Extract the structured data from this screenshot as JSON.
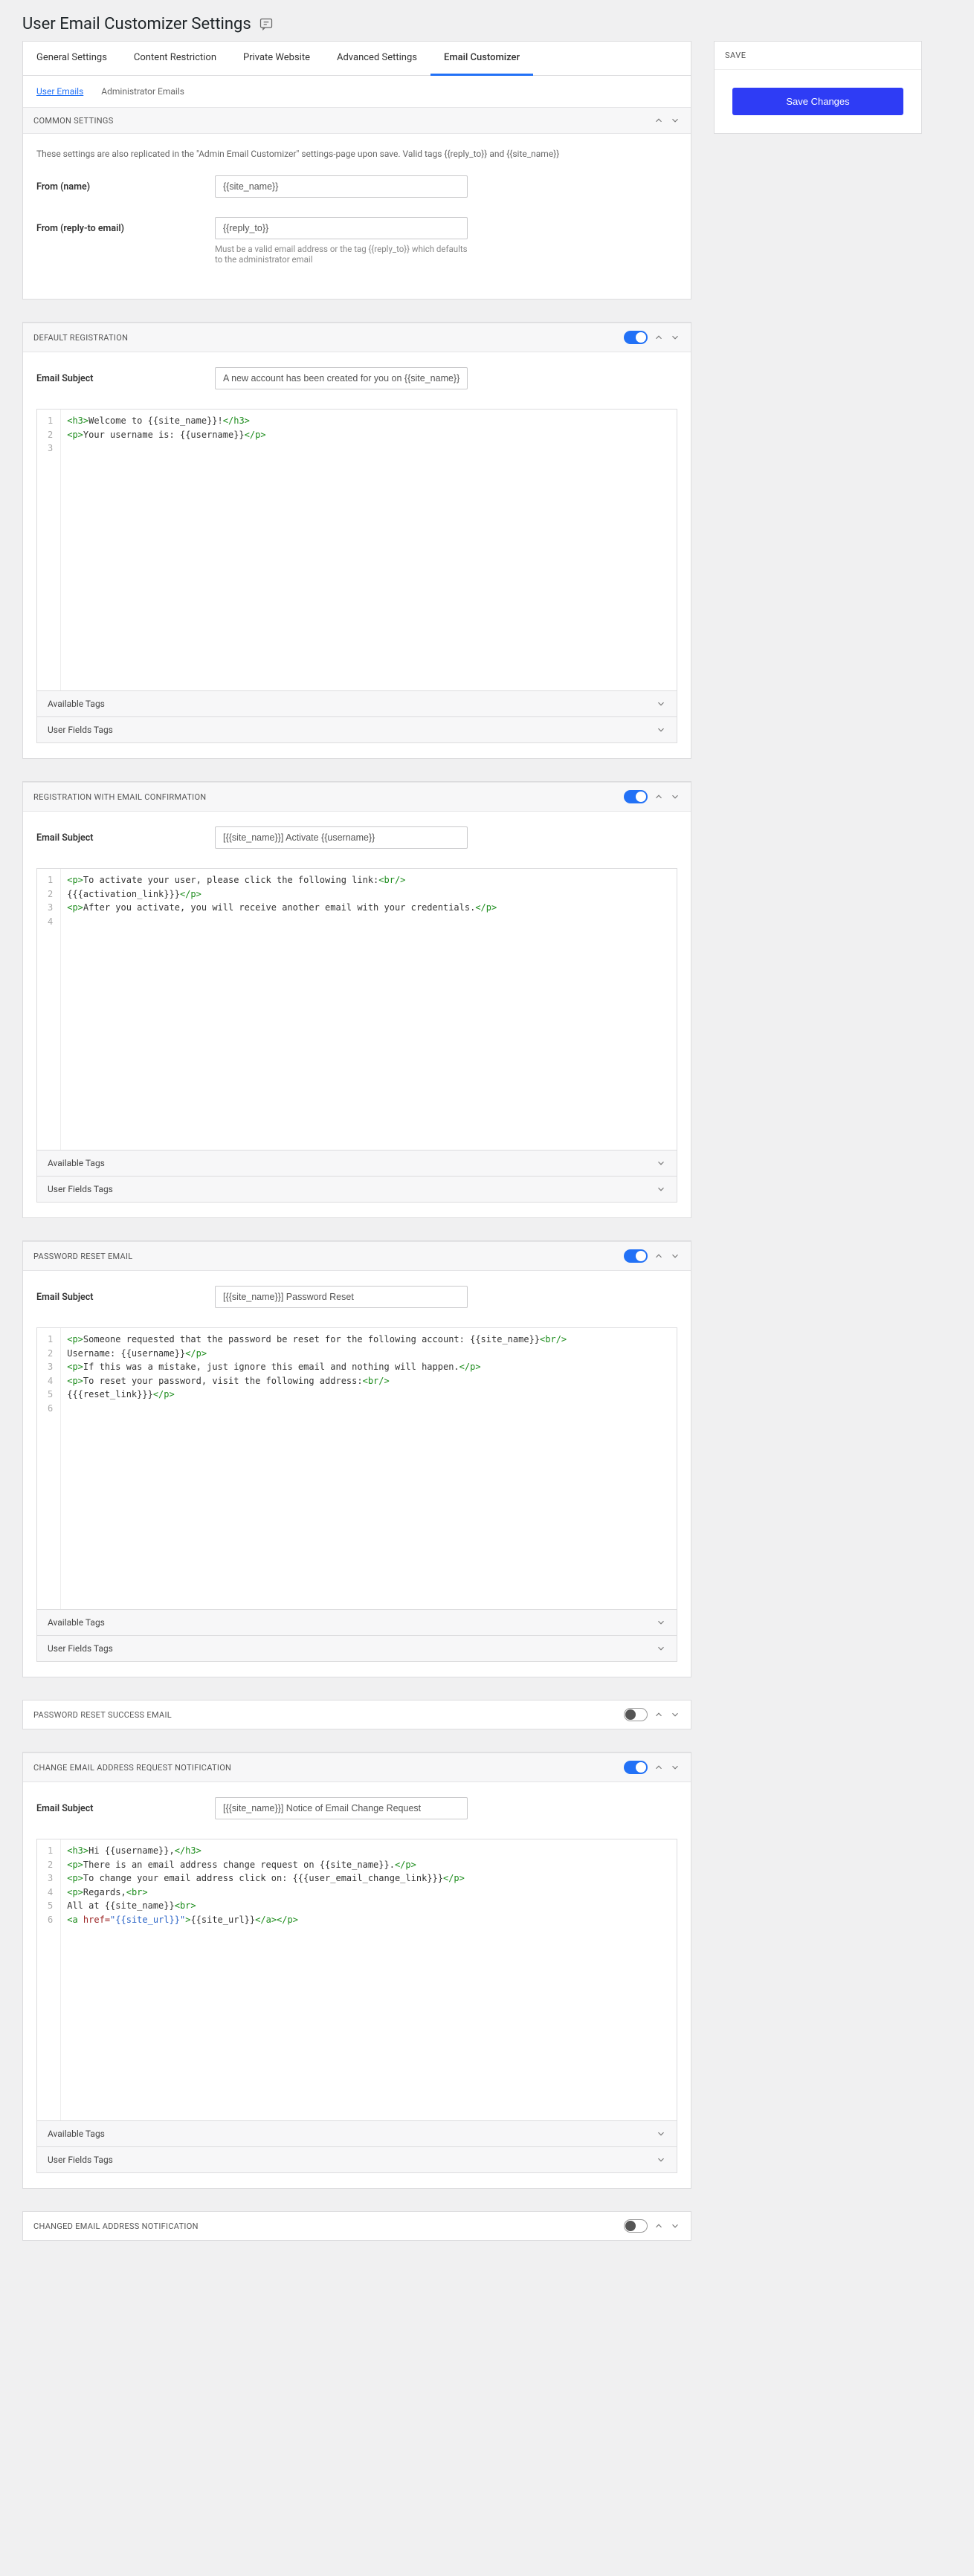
{
  "page_title": "User Email Customizer Settings",
  "tabs": [
    "General Settings",
    "Content Restriction",
    "Private Website",
    "Advanced Settings",
    "Email Customizer"
  ],
  "active_tab": 4,
  "subtabs": [
    "User Emails",
    "Administrator Emails"
  ],
  "active_subtab": 0,
  "save_panel": {
    "header": "SAVE",
    "button": "Save Changes"
  },
  "tag_groups": {
    "available": "Available Tags",
    "user_fields": "User Fields Tags"
  },
  "common": {
    "header": "COMMON SETTINGS",
    "hint": "These settings are also replicated in the \"Admin Email Customizer\" settings-page upon save. Valid tags {{reply_to}} and {{site_name}}",
    "from_name_label": "From (name)",
    "from_name_value": "{{site_name}}",
    "from_reply_label": "From (reply-to email)",
    "from_reply_value": "{{reply_to}}",
    "from_reply_hint": "Must be a valid email address or the tag {{reply_to}} which defaults to the administrator email"
  },
  "default_reg": {
    "header": "DEFAULT REGISTRATION",
    "enabled": true,
    "subject_label": "Email Subject",
    "subject_value": "A new account has been created for you on {{site_name}}",
    "code_lines": [
      [
        {
          "c": "tag",
          "t": "<h3>"
        },
        {
          "t": "Welcome to {{site_name}}!"
        },
        {
          "c": "tag",
          "t": "</h3>"
        }
      ],
      [
        {
          "c": "tag",
          "t": "<p>"
        },
        {
          "t": "Your username is: {{username}}"
        },
        {
          "c": "tag",
          "t": "</p>"
        }
      ],
      []
    ]
  },
  "reg_confirm": {
    "header": "REGISTRATION WITH EMAIL CONFIRMATION",
    "enabled": true,
    "subject_label": "Email Subject",
    "subject_value": "[{{site_name}}] Activate {{username}}",
    "code_lines": [
      [
        {
          "c": "tag",
          "t": "<p>"
        },
        {
          "t": "To activate your user, please click the following link:"
        },
        {
          "c": "tag",
          "t": "<br/>"
        }
      ],
      [
        {
          "t": "{{{activation_link}}}"
        },
        {
          "c": "tag",
          "t": "</p>"
        }
      ],
      [
        {
          "c": "tag",
          "t": "<p>"
        },
        {
          "t": "After you activate, you will receive another email with your credentials."
        },
        {
          "c": "tag",
          "t": "</p>"
        }
      ],
      []
    ]
  },
  "pw_reset": {
    "header": "PASSWORD RESET EMAIL",
    "enabled": true,
    "subject_label": "Email Subject",
    "subject_value": "[{{site_name}}] Password Reset",
    "code_lines": [
      [
        {
          "c": "tag",
          "t": "<p>"
        },
        {
          "t": "Someone requested that the password be reset for the following account: {{site_name}}"
        },
        {
          "c": "tag",
          "t": "<br/>"
        }
      ],
      [
        {
          "t": "Username: {{username}}"
        },
        {
          "c": "tag",
          "t": "</p>"
        }
      ],
      [
        {
          "c": "tag",
          "t": "<p>"
        },
        {
          "t": "If this was a mistake, just ignore this email and nothing will happen."
        },
        {
          "c": "tag",
          "t": "</p>"
        }
      ],
      [
        {
          "c": "tag",
          "t": "<p>"
        },
        {
          "t": "To reset your password, visit the following address:"
        },
        {
          "c": "tag",
          "t": "<br/>"
        }
      ],
      [
        {
          "t": "{{{reset_link}}}"
        },
        {
          "c": "tag",
          "t": "</p>"
        }
      ],
      []
    ]
  },
  "pw_reset_success": {
    "header": "PASSWORD RESET SUCCESS EMAIL",
    "enabled": false
  },
  "change_email_req": {
    "header": "CHANGE EMAIL ADDRESS REQUEST NOTIFICATION",
    "enabled": true,
    "subject_label": "Email Subject",
    "subject_value": "[{{site_name}}] Notice of Email Change Request",
    "code_lines": [
      [
        {
          "c": "tag",
          "t": "<h3>"
        },
        {
          "t": "Hi {{username}},"
        },
        {
          "c": "tag",
          "t": "</h3>"
        }
      ],
      [
        {
          "c": "tag",
          "t": "<p>"
        },
        {
          "t": "There is an email address change request on {{site_name}}."
        },
        {
          "c": "tag",
          "t": "</p>"
        }
      ],
      [
        {
          "c": "tag",
          "t": "<p>"
        },
        {
          "t": "To change your email address click on: {{{user_email_change_link}}}"
        },
        {
          "c": "tag",
          "t": "</p>"
        }
      ],
      [
        {
          "c": "tag",
          "t": "<p>"
        },
        {
          "t": "Regards,"
        },
        {
          "c": "tag",
          "t": "<br>"
        }
      ],
      [
        {
          "t": "All at {{site_name}}"
        },
        {
          "c": "tag",
          "t": "<br>"
        }
      ],
      [
        {
          "c": "tag",
          "t": "<a "
        },
        {
          "c": "attr",
          "t": "href="
        },
        {
          "c": "str",
          "t": "\"{{site_url}}\""
        },
        {
          "c": "tag",
          "t": ">"
        },
        {
          "t": "{{site_url}}"
        },
        {
          "c": "tag",
          "t": "</a></p>"
        }
      ]
    ]
  },
  "changed_email": {
    "header": "CHANGED EMAIL ADDRESS NOTIFICATION",
    "enabled": false
  }
}
